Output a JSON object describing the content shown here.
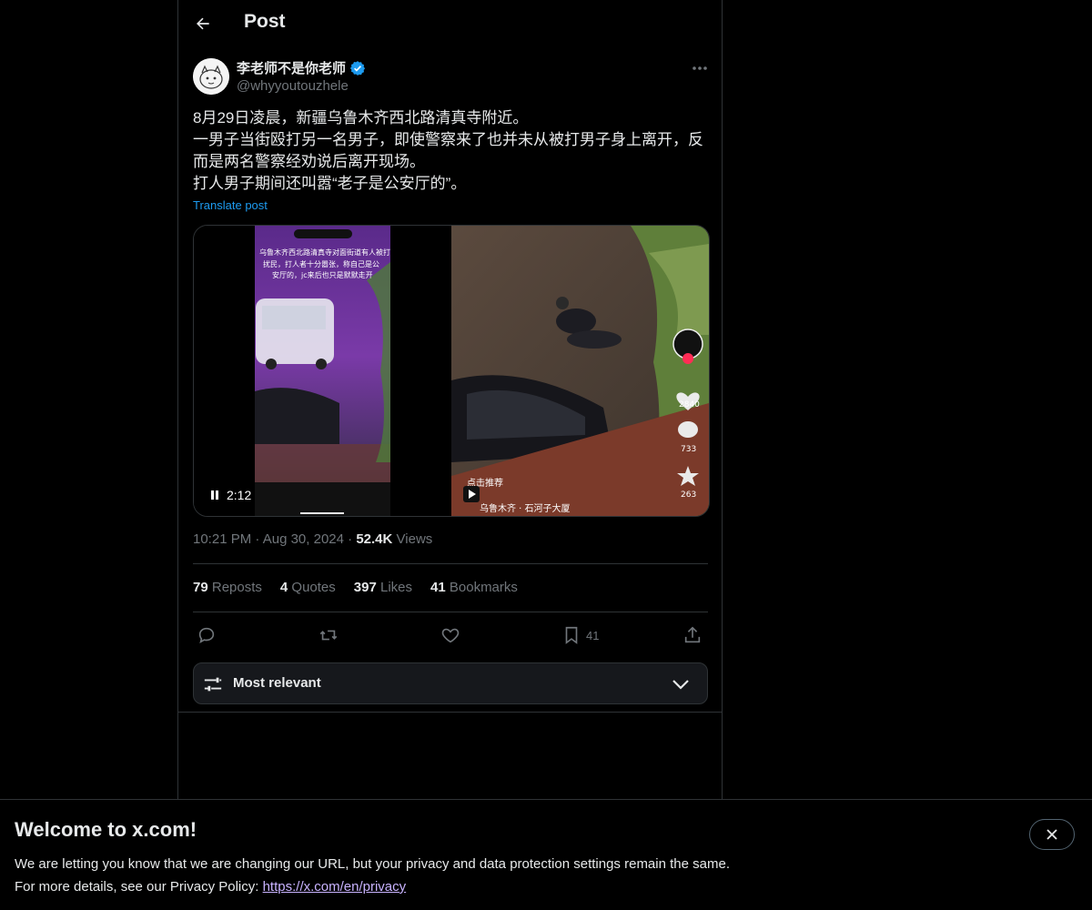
{
  "header": {
    "title": "Post"
  },
  "author": {
    "name": "李老师不是你老师",
    "handle": "@whyyoutouzhele"
  },
  "post": {
    "lines": [
      "8月29日凌晨，新疆乌鲁木齐西北路清真寺附近。",
      "一男子当街殴打另一名男子，即使警察来了也并未从被打男子身上离开，反",
      "而是两名警察经劝说后离开现场。",
      "打人男子期间还叫嚣“老子是公安厅的”。"
    ],
    "translate_label": "Translate post",
    "time": "10:21 PM",
    "date": "Aug 30, 2024",
    "views_count": "52.4K",
    "views_label": "Views"
  },
  "video": {
    "duration": "2:12",
    "overlay_top": "乌鲁木齐西北路清真寺对面街道有人被打",
    "overlay_text1": "扰民，打人者十分嚣张，称自己是公",
    "overlay_text2": "安厅的，jc来后也只是默默走开",
    "recommend": "点击推荐",
    "location": "乌鲁木齐 · 石河子大厦",
    "likes": "2840",
    "comments": "733",
    "stars": "263"
  },
  "stats": {
    "reposts_count": "79",
    "reposts_label": "Reposts",
    "quotes_count": "4",
    "quotes_label": "Quotes",
    "likes_count": "397",
    "likes_label": "Likes",
    "bookmarks_count": "41",
    "bookmarks_label": "Bookmarks"
  },
  "actions": {
    "bookmark_count": "41"
  },
  "sort": {
    "label": "Most relevant"
  },
  "banner": {
    "title": "Welcome to x.com!",
    "line1": "We are letting you know that we are changing our URL, but your privacy and data protection settings remain the same.",
    "line2_prefix": "For more details, see our Privacy Policy: ",
    "link": "https://x.com/en/privacy"
  },
  "colors": {
    "accent": "#1d9bf0",
    "muted": "#71767b",
    "border": "#2f3336",
    "link_visited": "#c9b3ff"
  }
}
